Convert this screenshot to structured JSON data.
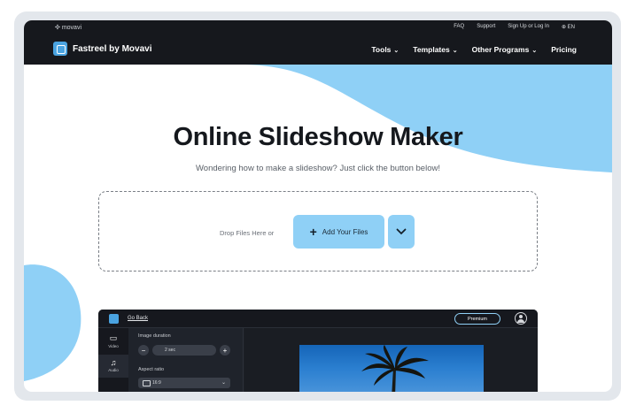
{
  "topbar": {
    "movavi_label": "movavi",
    "faq": "FAQ",
    "support": "Support",
    "signup": "Sign Up or Log In",
    "language": "EN"
  },
  "brand": {
    "name": "Fastreel by Movavi"
  },
  "nav": {
    "tools": "Tools",
    "templates": "Templates",
    "other_programs": "Other Programs",
    "pricing": "Pricing"
  },
  "hero": {
    "title": "Online Slideshow Maker",
    "subtitle": "Wondering how to make a slideshow? Just click the button below!"
  },
  "upload": {
    "drop_text": "Drop Files Here or",
    "add_label": "Add Your Files"
  },
  "editor": {
    "go_back": "Go Back",
    "premium": "Premium",
    "side_items": [
      {
        "label": "Video",
        "icon": "video-camera-icon"
      },
      {
        "label": "Audio",
        "icon": "music-note-icon"
      }
    ],
    "image_duration_label": "Image duration",
    "duration_value": "2 sec",
    "aspect_ratio_label": "Aspect ratio",
    "aspect_ratio_value": "16:9"
  },
  "colors": {
    "accent": "#8fd0f6",
    "topbar": "#16181d",
    "blob": "#8fd0f6"
  }
}
